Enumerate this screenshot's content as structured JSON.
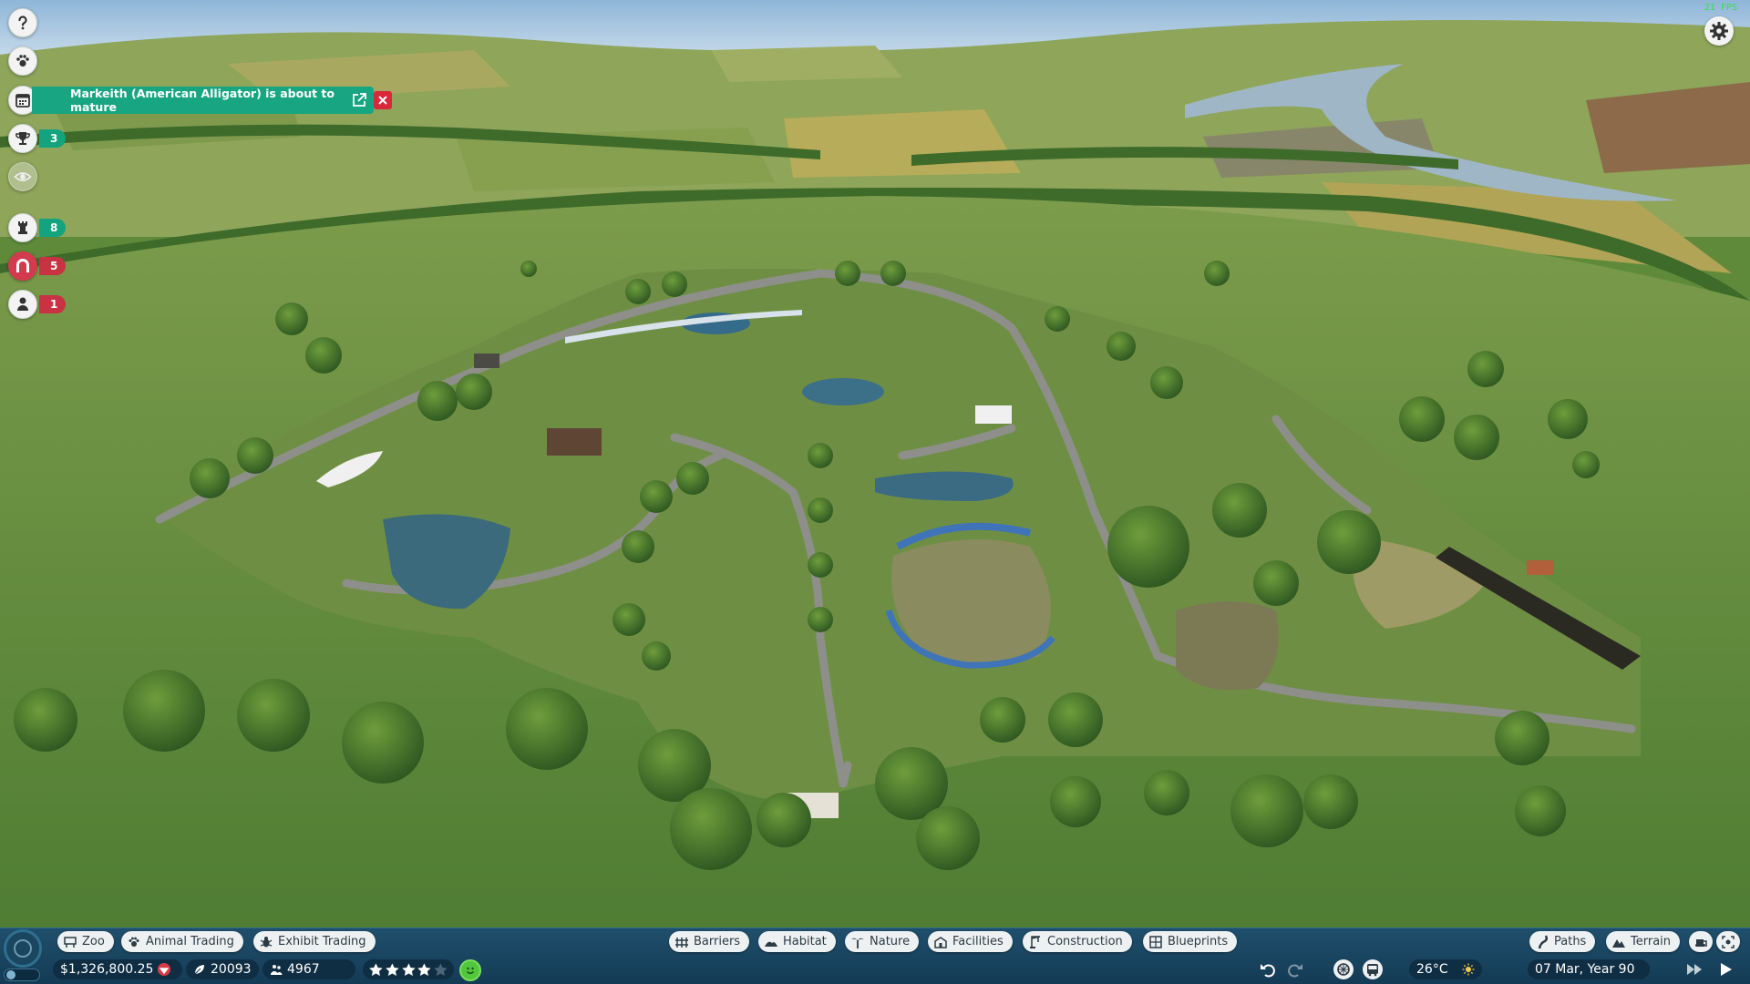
{
  "notification": {
    "text": "Markeith (American Alligator) is about to mature",
    "open_icon": "external-link-icon",
    "close_icon": "close-icon"
  },
  "rail": {
    "help_icon": "question-icon",
    "animals_icon": "paw-icon",
    "calendar_icon": "calendar-icon",
    "objectives": {
      "icon": "trophy-icon",
      "count": "3"
    },
    "view_icon": "eye-icon",
    "keepers": {
      "icon": "chess-rook-icon",
      "count": "8"
    },
    "facilities": {
      "icon": "arch-icon",
      "count": "5"
    },
    "staff": {
      "icon": "person-icon",
      "count": "1"
    }
  },
  "fps": "21 FPS",
  "toolbar": {
    "zoo": "Zoo",
    "animal_trading": "Animal Trading",
    "exhibit_trading": "Exhibit Trading",
    "barriers": "Barriers",
    "habitat": "Habitat",
    "nature": "Nature",
    "facilities": "Facilities",
    "construction": "Construction",
    "blueprints": "Blueprints",
    "paths": "Paths",
    "terrain": "Terrain"
  },
  "status": {
    "money": "$1,326,800.25",
    "conservation_credits": "20093",
    "guests": "4967",
    "rating_stars": 4,
    "rating_max": 5,
    "temperature": "26°C",
    "date": "07 Mar, Year 90"
  },
  "colors": {
    "accent_green": "#17a681",
    "alert_red": "#c83243",
    "bar_blue": "#1f4f6c"
  }
}
